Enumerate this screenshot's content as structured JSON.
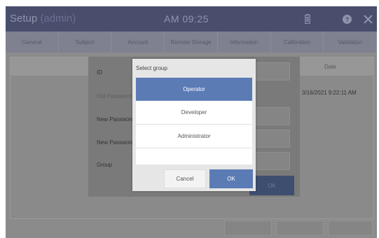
{
  "app": {
    "title": "Setup",
    "title_suffix": "(admin)",
    "clock": "AM 09:25"
  },
  "tabs": [
    "General",
    "Subject",
    "Account",
    "Remote Storage",
    "Information",
    "Calibration",
    "Validation"
  ],
  "table": {
    "date_header": "Date",
    "rows": [
      {
        "date": "3/16/2021 9:22:11 AM"
      }
    ]
  },
  "password_dialog": {
    "labels": [
      "ID",
      "Old Password",
      "New Password",
      "New Password",
      "Group"
    ],
    "ok_label": "OK"
  },
  "select_group": {
    "title": "Select group",
    "options": [
      "Operator",
      "Developer",
      "Administrator",
      ""
    ],
    "selected": "Operator",
    "cancel_label": "Cancel",
    "ok_label": "OK"
  },
  "colors": {
    "accent": "#5b7bb5",
    "titlebar": "#4a4e6d",
    "overlay_dim": "#8b8b8b"
  }
}
